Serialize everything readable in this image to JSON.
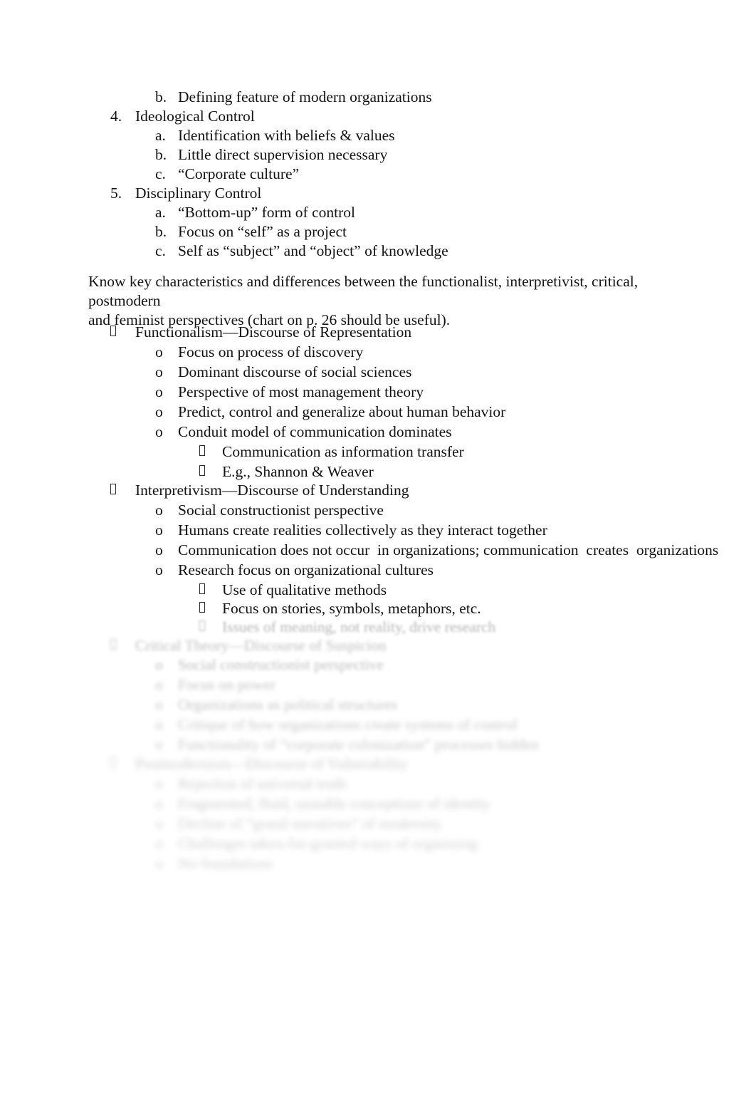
{
  "document": {
    "background_color": "#ffffff",
    "text_color": "#131313",
    "faded_text_color": "#5a5a5a",
    "bullet_glyph_name": "tofu-missing-glyph-box"
  },
  "outline_top": [
    {
      "level": 2,
      "marker": "b.",
      "text": "Defining feature of modern organizations"
    },
    {
      "level": 1,
      "marker": "4.",
      "text": "Ideological Control"
    },
    {
      "level": 2,
      "marker": "a.",
      "text": "Identification with beliefs & values"
    },
    {
      "level": 2,
      "marker": "b.",
      "text": "Little direct supervision necessary"
    },
    {
      "level": 2,
      "marker": "c.",
      "text": "“Corporate culture”"
    },
    {
      "level": 1,
      "marker": "5.",
      "text": "Disciplinary Control"
    },
    {
      "level": 2,
      "marker": "a.",
      "text": "“Bottom-up” form of control"
    },
    {
      "level": 2,
      "marker": "b.",
      "text": "Focus on “self” as a project"
    },
    {
      "level": 2,
      "marker": "c.",
      "text": "Self as “subject” and “object” of knowledge"
    }
  ],
  "paragraph": {
    "line1": "Know key characteristics and differences between the functionalist, interpretivist, critical, postmodern",
    "line2": "and feminist perspectives (chart on p. 26 should be useful)."
  },
  "outline_perspectives": [
    {
      "level": 0,
      "marker": "tofu",
      "text": "Functionalism—Discourse of Representation"
    },
    {
      "level": 2,
      "marker": "o",
      "text": "Focus on process of discovery"
    },
    {
      "level": 2,
      "marker": "o",
      "text": "Dominant discourse of social sciences"
    },
    {
      "level": 2,
      "marker": "o",
      "text": "Perspective of most management theory"
    },
    {
      "level": 2,
      "marker": "o",
      "text": "Predict, control and generalize about human behavior"
    },
    {
      "level": 2,
      "marker": "o",
      "text": "Conduit model of communication dominates"
    },
    {
      "level": 3,
      "marker": "tofu",
      "text": "Communication as information transfer"
    },
    {
      "level": 3,
      "marker": "tofu",
      "text": "E.g., Shannon & Weaver"
    },
    {
      "level": 0,
      "marker": "tofu",
      "text": "Interpretivism—Discourse of Understanding"
    },
    {
      "level": 2,
      "marker": "o",
      "text": "Social constructionist perspective"
    },
    {
      "level": 2,
      "marker": "o",
      "text": "Humans create realities collectively as they interact together"
    },
    {
      "level": 2,
      "marker": "o",
      "text": "Communication does not occur  in organizations; communication  creates  organizations"
    },
    {
      "level": 2,
      "marker": "o",
      "text": "Research focus on organizational cultures"
    },
    {
      "level": 3,
      "marker": "tofu",
      "text": "Use of qualitative methods"
    },
    {
      "level": 3,
      "marker": "tofu",
      "text": "Focus on stories, symbols, metaphors, etc."
    }
  ],
  "outline_faded": [
    {
      "level": 3,
      "marker": "tofu",
      "text": "Issues of meaning, not reality, drive research",
      "blur": "f1"
    },
    {
      "level": 0,
      "marker": "tofu",
      "text": "Critical Theory—Discourse of Suspicion",
      "blur": "f2"
    },
    {
      "level": 2,
      "marker": "o",
      "text": "Social constructionist perspective",
      "blur": "f2"
    },
    {
      "level": 2,
      "marker": "o",
      "text": "Focus on power",
      "blur": "f3"
    },
    {
      "level": 2,
      "marker": "o",
      "text": "Organizations as political structures",
      "blur": "f3"
    },
    {
      "level": 2,
      "marker": "o",
      "text": "Critique of how organizations create systems of control",
      "blur": "f4"
    },
    {
      "level": 2,
      "marker": "o",
      "text": "Functionality of “corporate colonization” processes hidden",
      "blur": "f4"
    },
    {
      "level": 0,
      "marker": "tofu",
      "text": "Postmodernism—Discourse of Vulnerability",
      "blur": "f5"
    },
    {
      "level": 2,
      "marker": "o",
      "text": "Rejection of universal truth",
      "blur": "f5"
    },
    {
      "level": 2,
      "marker": "o",
      "text": "Fragmented, fluid, unstable conceptions of identity",
      "blur": "f5"
    },
    {
      "level": 2,
      "marker": "o",
      "text": "Decline of “grand narratives” of modernity",
      "blur": "f6"
    },
    {
      "level": 2,
      "marker": "o",
      "text": "Challenges taken-for-granted ways of organizing",
      "blur": "f6"
    },
    {
      "level": 2,
      "marker": "o",
      "text": "No foundations",
      "blur": "f6"
    }
  ]
}
